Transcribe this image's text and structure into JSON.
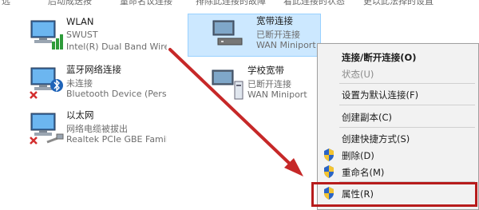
{
  "top_fragments": [
    "远",
    "后动成迭按",
    "量命名议连接",
    "排除此连接的故障",
    "看此连接的状态",
    "更以此法择的设直"
  ],
  "connections": [
    {
      "name": "WLAN",
      "status": "SWUST",
      "device": "Intel(R) Dual Band Wirele..."
    },
    {
      "name": "蓝牙网络连接",
      "status": "未连接",
      "device": "Bluetooth Device (Perso..."
    },
    {
      "name": "以太网",
      "status": "网络电缆被拔出",
      "device": "Realtek PCIe GBE Family ..."
    },
    {
      "name": "宽带连接",
      "status": "已断开连接",
      "device": "WAN Miniport"
    },
    {
      "name": "学校宽带",
      "status": "已断开连接",
      "device": "WAN Miniport"
    }
  ],
  "context_menu": {
    "items": [
      {
        "label": "连接/断开连接(O)"
      },
      {
        "label": "状态(U)"
      },
      {
        "label": "设置为默认连接(F)"
      },
      {
        "label": "创建副本(C)"
      },
      {
        "label": "创建快捷方式(S)"
      },
      {
        "label": "删除(D)"
      },
      {
        "label": "重命名(M)"
      },
      {
        "label": "属性(R)"
      }
    ]
  },
  "colors": {
    "annotation_red": "#c62828",
    "selection_bg": "#cce8ff"
  }
}
